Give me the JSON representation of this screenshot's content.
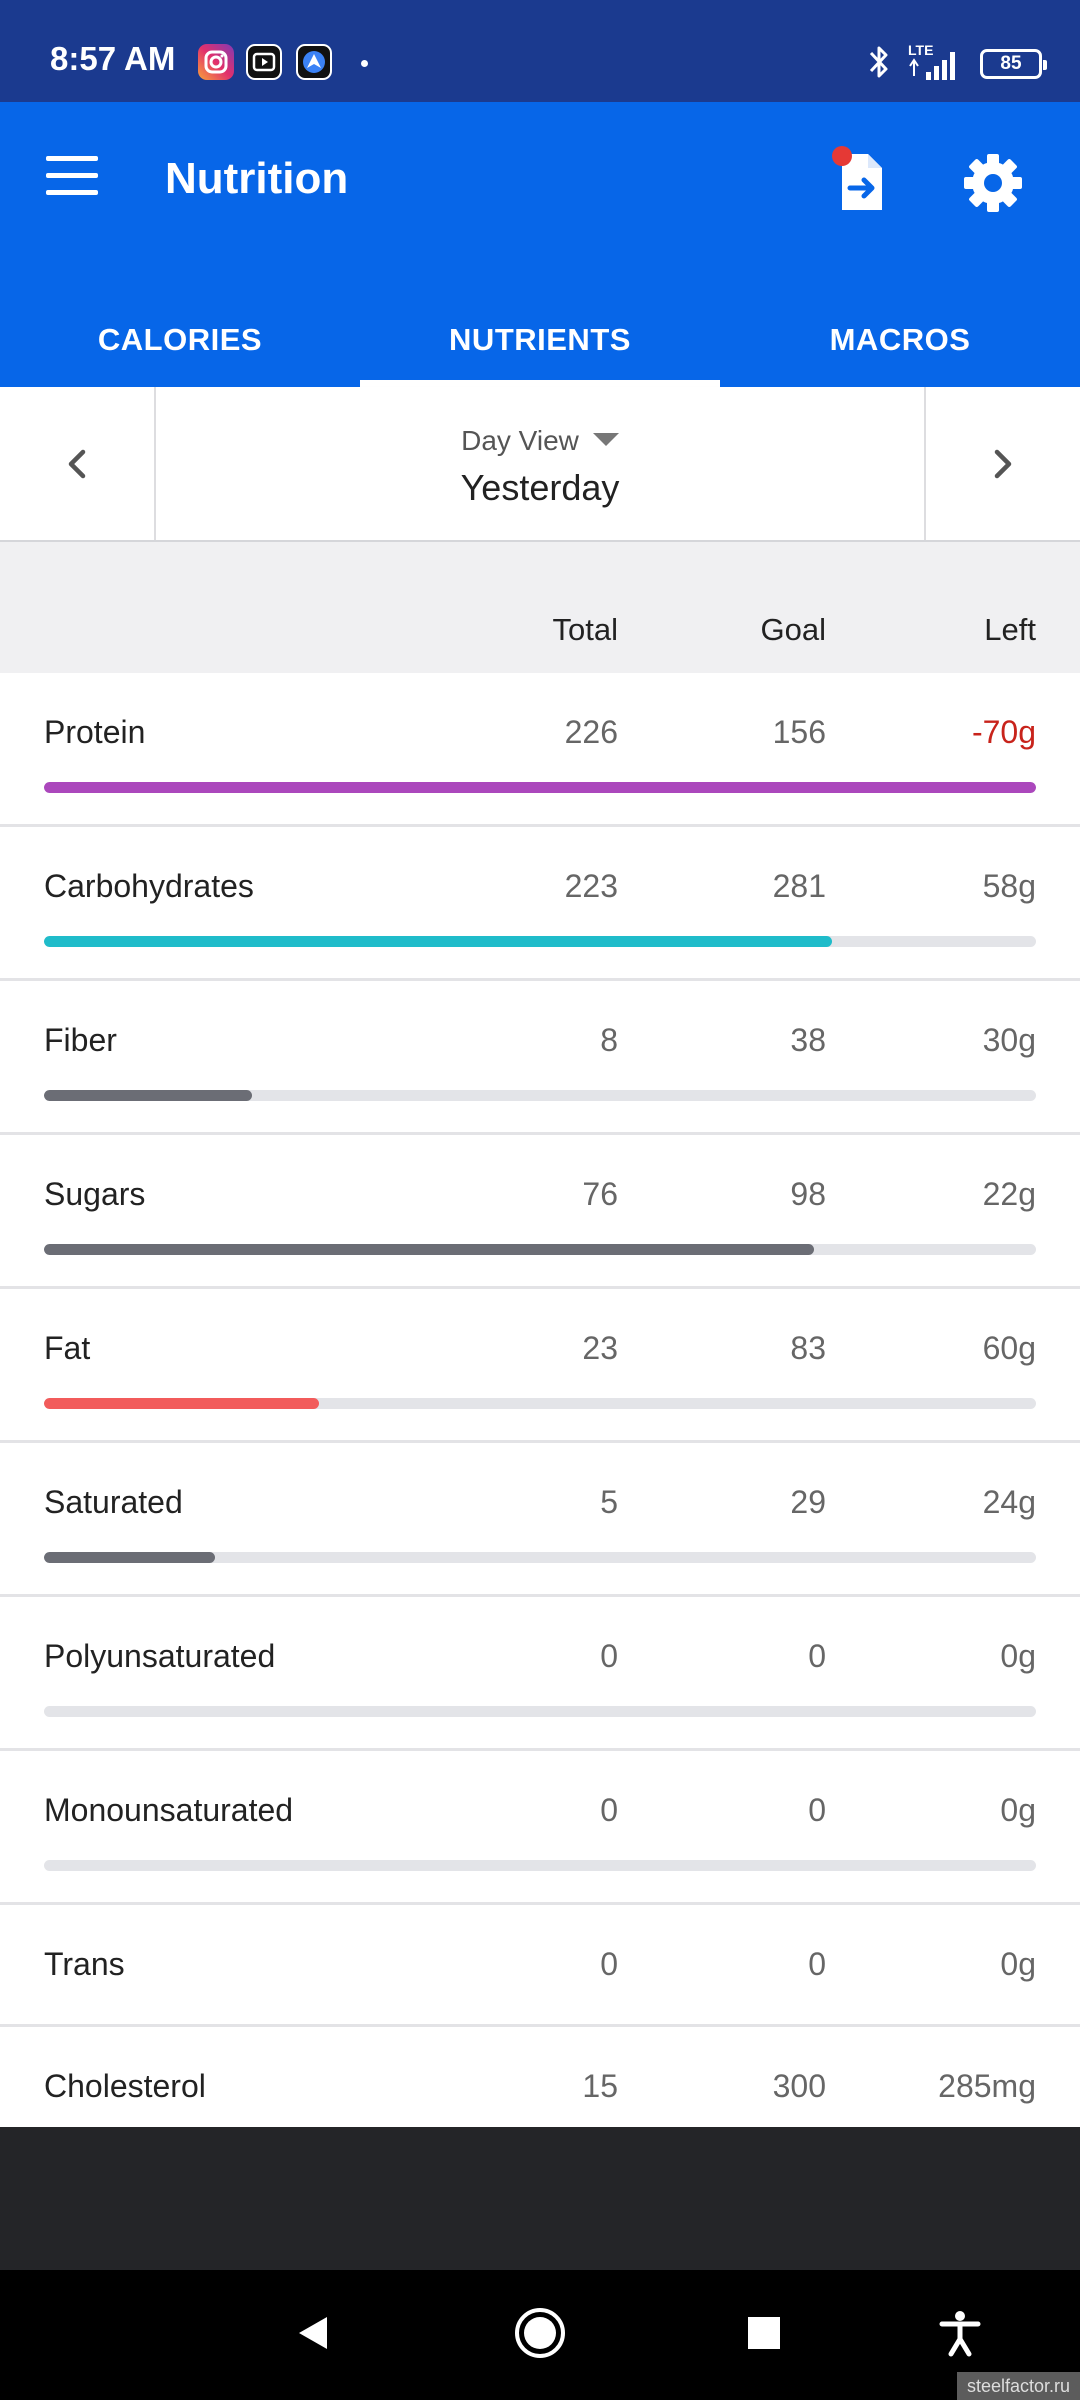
{
  "status_bar": {
    "time": "8:57 AM",
    "network": "LTE",
    "battery": "85"
  },
  "app_bar": {
    "title": "Nutrition"
  },
  "tabs": [
    {
      "label": "CALORIES",
      "active": false
    },
    {
      "label": "NUTRIENTS",
      "active": true
    },
    {
      "label": "MACROS",
      "active": false
    }
  ],
  "date_nav": {
    "view_mode": "Day View",
    "date": "Yesterday"
  },
  "table": {
    "headers": {
      "total": "Total",
      "goal": "Goal",
      "left": "Left"
    },
    "rows": [
      {
        "name": "Protein",
        "total": "226",
        "goal": "156",
        "left": "-70g",
        "progress": 1.0,
        "color": "#ab47bc",
        "over": true
      },
      {
        "name": "Carbohydrates",
        "total": "223",
        "goal": "281",
        "left": "58g",
        "progress": 0.794,
        "color": "#1fbcca",
        "over": false
      },
      {
        "name": "Fiber",
        "total": "8",
        "goal": "38",
        "left": "30g",
        "progress": 0.21,
        "color": "#6b6d75",
        "over": false
      },
      {
        "name": "Sugars",
        "total": "76",
        "goal": "98",
        "left": "22g",
        "progress": 0.776,
        "color": "#6b6d75",
        "over": false
      },
      {
        "name": "Fat",
        "total": "23",
        "goal": "83",
        "left": "60g",
        "progress": 0.277,
        "color": "#f25b5b",
        "over": false
      },
      {
        "name": "Saturated",
        "total": "5",
        "goal": "29",
        "left": "24g",
        "progress": 0.172,
        "color": "#6b6d75",
        "over": false
      },
      {
        "name": "Polyunsaturated",
        "total": "0",
        "goal": "0",
        "left": "0g",
        "progress": 0,
        "color": "#6b6d75",
        "over": false
      },
      {
        "name": "Monounsaturated",
        "total": "0",
        "goal": "0",
        "left": "0g",
        "progress": 0,
        "color": "#6b6d75",
        "over": false
      },
      {
        "name": "Trans",
        "total": "0",
        "goal": "0",
        "left": "0g",
        "progress": null,
        "color": "#6b6d75",
        "over": false
      },
      {
        "name": "Cholesterol",
        "total": "15",
        "goal": "300",
        "left": "285mg",
        "progress": null,
        "color": "#6b6d75",
        "over": false
      }
    ]
  },
  "watermark": "steelfactor.ru",
  "colors": {
    "status_bar": "#1b3a8f",
    "app_bar": "#0766e8",
    "over_goal": "#c8231b",
    "notification_dot": "#e53935"
  },
  "icons": {
    "menu": "menu-icon",
    "export": "export-file-icon",
    "settings": "gear-icon",
    "prev": "chevron-left-icon",
    "next": "chevron-right-icon"
  }
}
